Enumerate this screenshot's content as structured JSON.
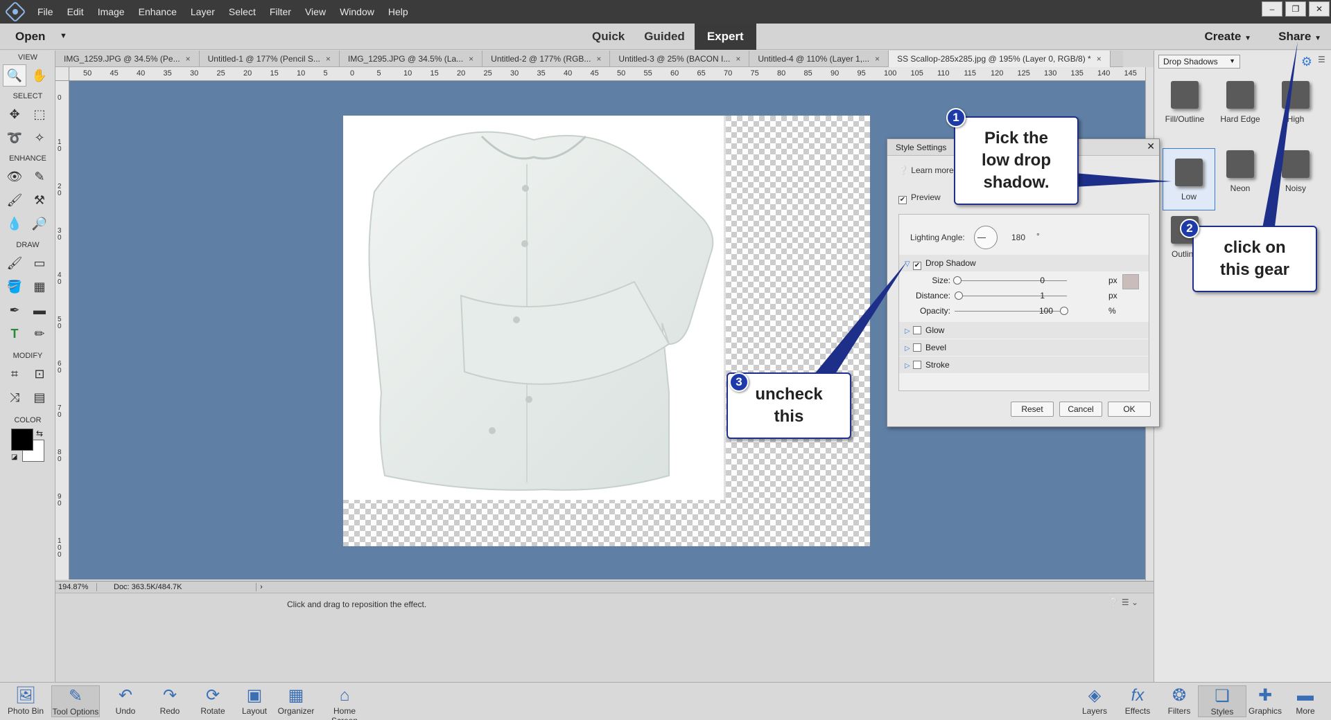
{
  "menubar": {
    "items": [
      "File",
      "Edit",
      "Image",
      "Enhance",
      "Layer",
      "Select",
      "Filter",
      "View",
      "Window",
      "Help"
    ],
    "window_controls": [
      "–",
      "❐",
      "✕"
    ]
  },
  "modebar": {
    "open_label": "Open",
    "modes": [
      "Quick",
      "Guided",
      "Expert"
    ],
    "active_mode": "Expert",
    "create_label": "Create",
    "share_label": "Share"
  },
  "toolbox": {
    "sections": [
      "VIEW",
      "SELECT",
      "ENHANCE",
      "DRAW",
      "MODIFY",
      "COLOR"
    ]
  },
  "doc_tabs": [
    "IMG_1259.JPG @ 34.5% (Pe...",
    "Untitled-1 @ 177% (Pencil S...",
    "IMG_1295.JPG @ 34.5% (La...",
    "Untitled-2 @ 177% (RGB...",
    "Untitled-3 @ 25% (BACON I...",
    "Untitled-4 @ 110% (Layer 1,...",
    "SS Scallop-285x285.jpg @ 195% (Layer 0, RGB/8) *"
  ],
  "ruler": {
    "top": [
      "50",
      "45",
      "40",
      "35",
      "30",
      "25",
      "20",
      "15",
      "10",
      "5",
      "0",
      "5",
      "10",
      "15",
      "20",
      "25",
      "30",
      "35",
      "40",
      "45",
      "50",
      "55",
      "60",
      "65",
      "70",
      "75",
      "80",
      "85",
      "90",
      "95",
      "100",
      "105",
      "110",
      "115",
      "120",
      "125",
      "130",
      "135",
      "140",
      "145"
    ],
    "left": [
      "0",
      "1 0",
      "2 0",
      "3 0",
      "4 0",
      "5 0",
      "6 0",
      "7 0",
      "8 0",
      "9 0",
      "1 0 0"
    ]
  },
  "statusbar": {
    "zoom": "194.87%",
    "doc": "Doc: 363.5K/484.7K"
  },
  "tooloptions": {
    "hint": "Click and drag to reposition the effect."
  },
  "rightpanel": {
    "dropdown": "Drop Shadows",
    "styles": [
      "Fill/Outline",
      "Hard Edge",
      "High",
      "Low",
      "Neon",
      "Noisy",
      "Outline"
    ]
  },
  "dialog": {
    "title": "Style Settings",
    "learn_more": "Learn more",
    "preview_label": "Preview",
    "lighting_label": "Lighting Angle:",
    "lighting_value": "180",
    "lighting_unit": "°",
    "drop_shadow_label": "Drop Shadow",
    "size_label": "Size:",
    "size_value": "0",
    "size_unit": "px",
    "distance_label": "Distance:",
    "distance_value": "1",
    "distance_unit": "px",
    "opacity_label": "Opacity:",
    "opacity_value": "100",
    "opacity_unit": "%",
    "glow_label": "Glow",
    "bevel_label": "Bevel",
    "stroke_label": "Stroke",
    "reset_label": "Reset",
    "cancel_label": "Cancel",
    "ok_label": "OK",
    "shadow_color": "#cbbcbc"
  },
  "callouts": {
    "c1_num": "1",
    "c1_line1": "Pick the",
    "c1_line2": "low drop",
    "c1_line3": "shadow.",
    "c2_num": "2",
    "c2_line1": "click on",
    "c2_line2": "this gear",
    "c3_num": "3",
    "c3_line1": "uncheck",
    "c3_line2": "this"
  },
  "bottombar": {
    "left": [
      "Photo Bin",
      "Tool Options",
      "Undo",
      "Redo",
      "Rotate",
      "Layout",
      "Organizer",
      "Home Screen"
    ],
    "right": [
      "Layers",
      "Effects",
      "Filters",
      "Styles",
      "Graphics",
      "More"
    ]
  },
  "colors": {
    "canvas_bg": "#5f7fa5",
    "accent": "#3a7bd5",
    "callout_border": "#1e2f8a"
  }
}
